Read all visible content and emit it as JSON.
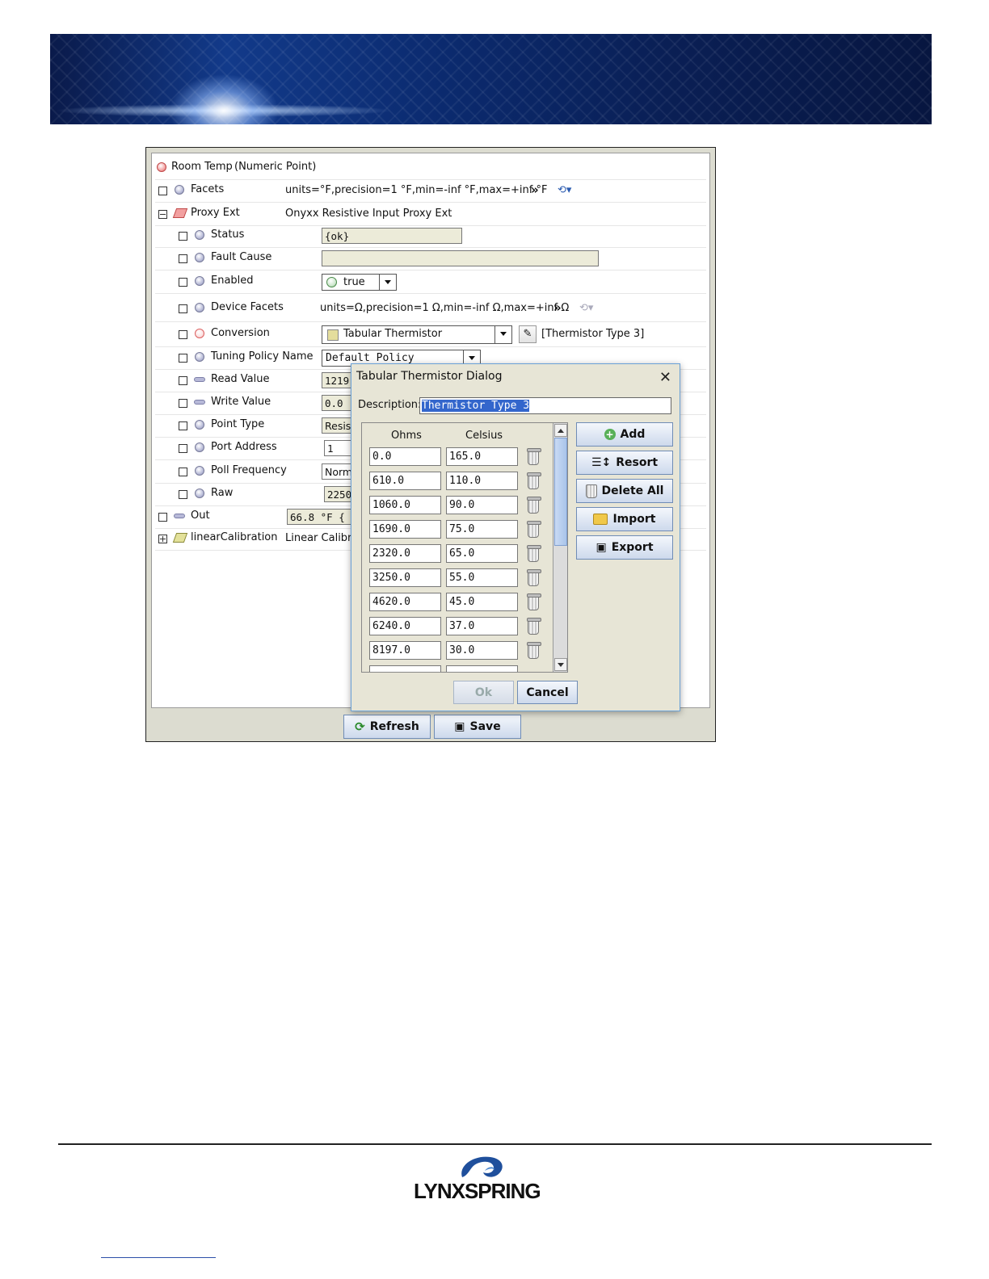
{
  "header": {
    "title": "Room Temp",
    "subtitle": "(Numeric Point)"
  },
  "rows": {
    "facets": {
      "label": "Facets",
      "value": "units=°F,precision=1 °F,min=-inf °F,max=+inf °F"
    },
    "proxy": {
      "label": "Proxy Ext",
      "value": "Onyxx Resistive Input Proxy Ext"
    },
    "status": {
      "label": "Status",
      "value": "{ok}"
    },
    "fault": {
      "label": "Fault Cause",
      "value": ""
    },
    "enabled": {
      "label": "Enabled",
      "value": "true"
    },
    "device_facets": {
      "label": "Device Facets",
      "value": "units=Ω,precision=1 Ω,min=-inf Ω,max=+inf Ω"
    },
    "conversion": {
      "label": "Conversion",
      "value": "Tabular Thermistor",
      "extra": "[Thermistor Type 3]"
    },
    "tuning": {
      "label": "Tuning Policy Name",
      "value": "Default Policy"
    },
    "read_value": {
      "label": "Read Value",
      "value": "1219"
    },
    "write_value": {
      "label": "Write Value",
      "value": "0.0"
    },
    "point_type": {
      "label": "Point Type",
      "value": "Resist"
    },
    "port_address": {
      "label": "Port Address",
      "value": "1"
    },
    "poll": {
      "label": "Poll Frequency",
      "value": "Norma"
    },
    "raw": {
      "label": "Raw",
      "value": "2250"
    },
    "out": {
      "label": "Out",
      "value": "66.8 °F {"
    },
    "linear": {
      "label": "linearCalibration",
      "value": "Linear Calibra"
    }
  },
  "bottom_buttons": {
    "refresh": "Refresh",
    "save": "Save"
  },
  "dialog": {
    "title": "Tabular Thermistor Dialog",
    "description_label": "Description:",
    "description_value": "Thermistor Type 3",
    "col_ohms": "Ohms",
    "col_celsius": "Celsius",
    "table": [
      {
        "ohms": "0.0",
        "celsius": "165.0"
      },
      {
        "ohms": "610.0",
        "celsius": "110.0"
      },
      {
        "ohms": "1060.0",
        "celsius": "90.0"
      },
      {
        "ohms": "1690.0",
        "celsius": "75.0"
      },
      {
        "ohms": "2320.0",
        "celsius": "65.0"
      },
      {
        "ohms": "3250.0",
        "celsius": "55.0"
      },
      {
        "ohms": "4620.0",
        "celsius": "45.0"
      },
      {
        "ohms": "6240.0",
        "celsius": "37.0"
      },
      {
        "ohms": "8197.0",
        "celsius": "30.0"
      }
    ],
    "buttons": {
      "add": "Add",
      "resort": "Resort",
      "delete_all": "Delete All",
      "import": "Import",
      "export": "Export",
      "ok": "Ok",
      "cancel": "Cancel"
    }
  },
  "footer": {
    "brand": "LYNXSPRING"
  },
  "colors": {
    "accent": "#6aa1d7",
    "panel": "#e7e5d6",
    "selection": "#3366cc"
  }
}
